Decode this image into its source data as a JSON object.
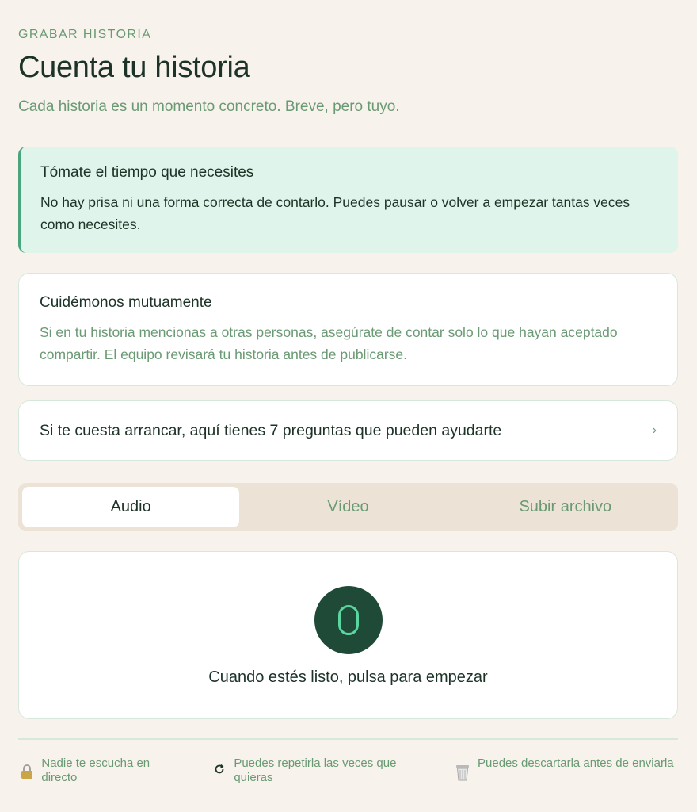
{
  "header": {
    "eyebrow": "GRABAR HISTORIA",
    "title": "Cuenta tu historia",
    "subtitle": "Cada historia es un momento concreto. Breve, pero tuyo."
  },
  "notice": {
    "title": "Tómate el tiempo que necesites",
    "body": "No hay prisa ni una forma correcta de contarlo. Puedes pausar o volver a empezar tantas veces como necesites."
  },
  "care": {
    "title": "Cuidémonos mutuamente",
    "body": "Si en tu historia mencionas a otras personas, asegúrate de contar solo lo que hayan aceptado compartir. El equipo revisará tu historia antes de publicarse."
  },
  "questions": {
    "label": "Si te cuesta arrancar, aquí tienes 7 preguntas que pueden ayudarte",
    "chevron": "›"
  },
  "tabs": [
    {
      "label": "Audio",
      "active": true
    },
    {
      "label": "Vídeo",
      "active": false
    },
    {
      "label": "Subir archivo",
      "active": false
    }
  ],
  "recorder": {
    "icon": "microphone-icon",
    "hint": "Cuando estés listo, pulsa para empezar"
  },
  "footer": [
    {
      "icon": "lock-icon",
      "text": "Nadie te escucha en directo"
    },
    {
      "icon": "refresh-icon",
      "text": "Puedes repetirla las veces que quieras"
    },
    {
      "icon": "trash-icon",
      "text": "Puedes descartarla antes de enviarla"
    }
  ],
  "colors": {
    "background": "#f7f2ec",
    "accent_green": "#6a9a74",
    "dark_green": "#1e4a37",
    "notice_bg": "#dff4ea",
    "tabs_bg": "#ece3d6"
  }
}
